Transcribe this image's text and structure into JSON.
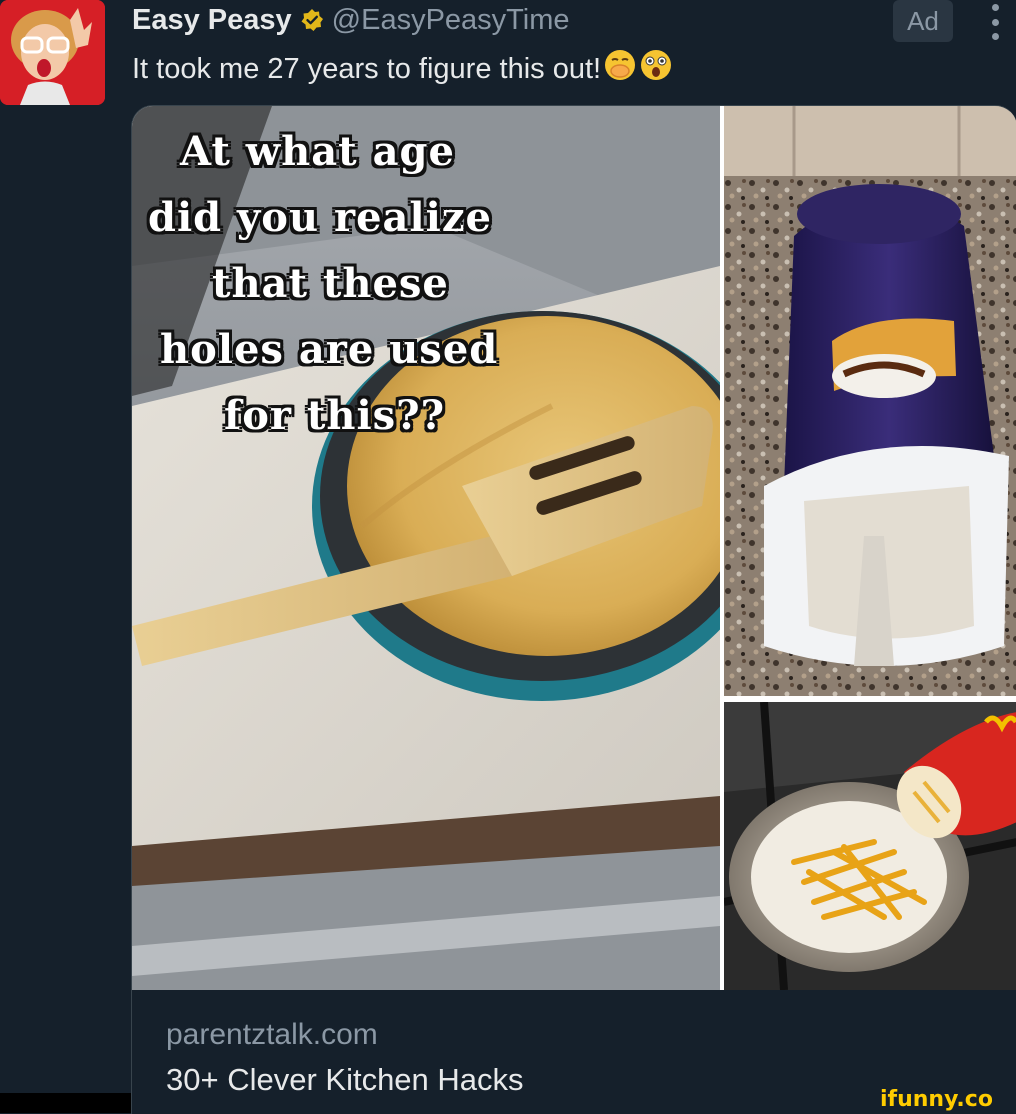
{
  "account": {
    "display_name": "Easy Peasy",
    "handle": "@EasyPeasyTime",
    "verified_icon": "verified-badge-icon",
    "avatar_icon": "avatar-woman-with-glasses"
  },
  "ad_label": "Ad",
  "more_icon": "vertical-ellipsis-icon",
  "tweet": {
    "text": "It took me 27 years to figure this out!",
    "emojis": [
      "face-with-hand-over-mouth-emoji",
      "face-with-open-mouth-emoji"
    ]
  },
  "media": {
    "overlay_lines": [
      "At what age",
      "did you realize",
      "that these",
      "holes are used",
      "for this??"
    ],
    "can_brand": "Pringles"
  },
  "link_card": {
    "domain": "parentztalk.com",
    "title": "30+ Clever Kitchen Hacks"
  },
  "watermark": "ifunny.co",
  "colors": {
    "background": "#15202b",
    "text_primary": "#e7e9ea",
    "text_secondary": "#8b98a5",
    "verified_gold": "#e2b719",
    "watermark": "#ffcc00"
  }
}
